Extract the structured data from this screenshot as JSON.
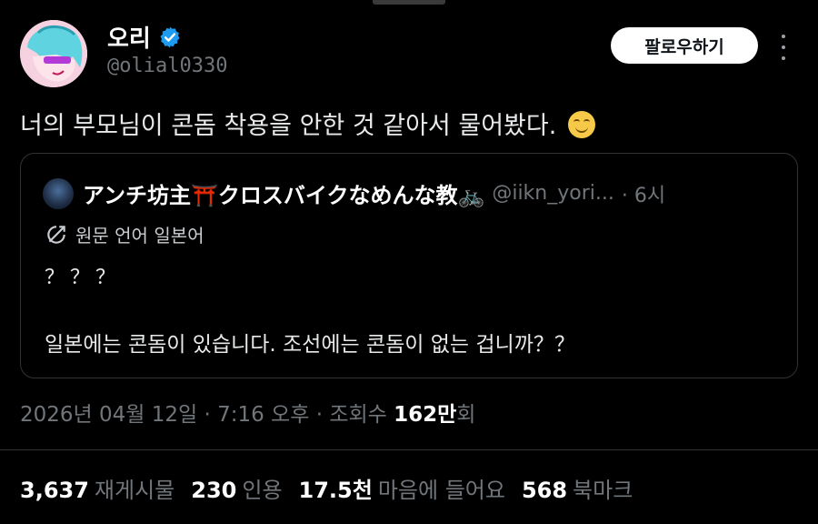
{
  "author": {
    "name": "오리",
    "handle": "@olial0330",
    "verified": true
  },
  "header": {
    "follow_label": "팔로우하기"
  },
  "tweet": {
    "text": "너의 부모님이 콘돔 착용을 안한 것 같아서 물어봤다."
  },
  "quote": {
    "name": "アンチ坊主⛩️クロスバイクなめんな教🚲",
    "handle": "@iikn_yori...",
    "time": "· 6시",
    "translate_label": "원문 언어 일본어",
    "line1": "？？？",
    "line2": "일본에는 콘돔이 있습니다. 조선에는 콘돔이 없는 겁니까？？"
  },
  "meta": {
    "date": "2026년 04월 12일 · 7:16 오후 · 조회수",
    "views_value": "162만",
    "views_suffix": "회"
  },
  "stats": {
    "reposts_value": "3,637",
    "reposts_label": "재게시물",
    "quotes_value": "230",
    "quotes_label": "인용",
    "likes_value": "17.5천",
    "likes_label": "마음에 들어요",
    "bookmarks_value": "568",
    "bookmarks_label": "북마크"
  },
  "colors": {
    "background": "#000000",
    "verified": "#1d9bf0",
    "muted_text": "#71767b",
    "border": "#2f3336"
  }
}
